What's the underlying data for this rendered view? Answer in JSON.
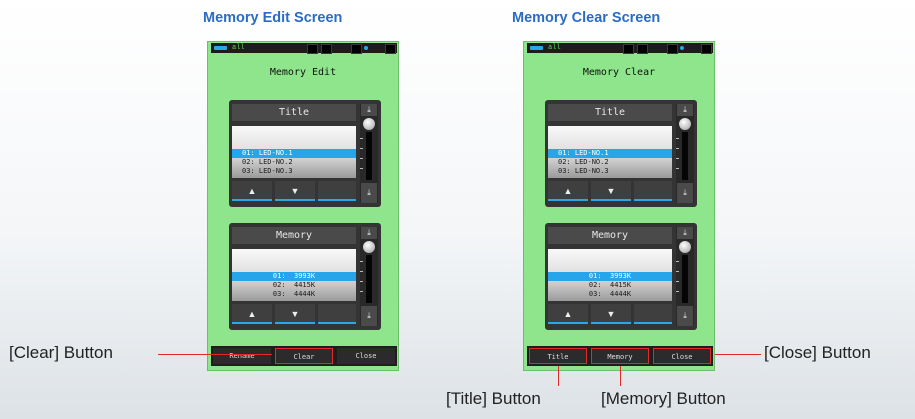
{
  "captions": {
    "left_heading": "Memory Edit Screen",
    "right_heading": "Memory Clear Screen",
    "clear_button": "[Clear] Button",
    "close_button": "[Close] Button",
    "title_button": "[Title] Button",
    "memory_button": "[Memory] Button"
  },
  "edit_screen": {
    "signal": "all",
    "title": "Memory Edit",
    "title_panel": {
      "header": "Title",
      "rows": [
        "01: LED-NO.1",
        "02: LED-NO.2",
        "03: LED-NO.3"
      ],
      "selected_index": 0
    },
    "memory_panel": {
      "header": "Memory",
      "rows": [
        "01:  3993K",
        "02:  4415K",
        "03:  4444K"
      ],
      "selected_index": 0
    },
    "bottom_buttons": [
      "Rename",
      "Clear",
      "Close"
    ]
  },
  "clear_screen": {
    "signal": "all",
    "title": "Memory Clear",
    "title_panel": {
      "header": "Title",
      "rows": [
        "01: LED-NO.1",
        "02: LED-NO.2",
        "03: LED-NO.3"
      ],
      "selected_index": 0
    },
    "memory_panel": {
      "header": "Memory",
      "rows": [
        "01:  3993K",
        "02:  4415K",
        "03:  4444K"
      ],
      "selected_index": 0
    },
    "bottom_buttons": [
      "Title",
      "Memory",
      "Close"
    ]
  },
  "icons": {
    "scroll_top": "double-up-arrow-icon",
    "scroll_bottom": "double-down-arrow-icon",
    "up": "up-arrow-icon",
    "down": "down-arrow-icon"
  },
  "colors": {
    "heading": "#2a6cc4",
    "device_background": "#8fe58c",
    "selection": "#27a5ea",
    "highlight": "#e02a2a"
  }
}
